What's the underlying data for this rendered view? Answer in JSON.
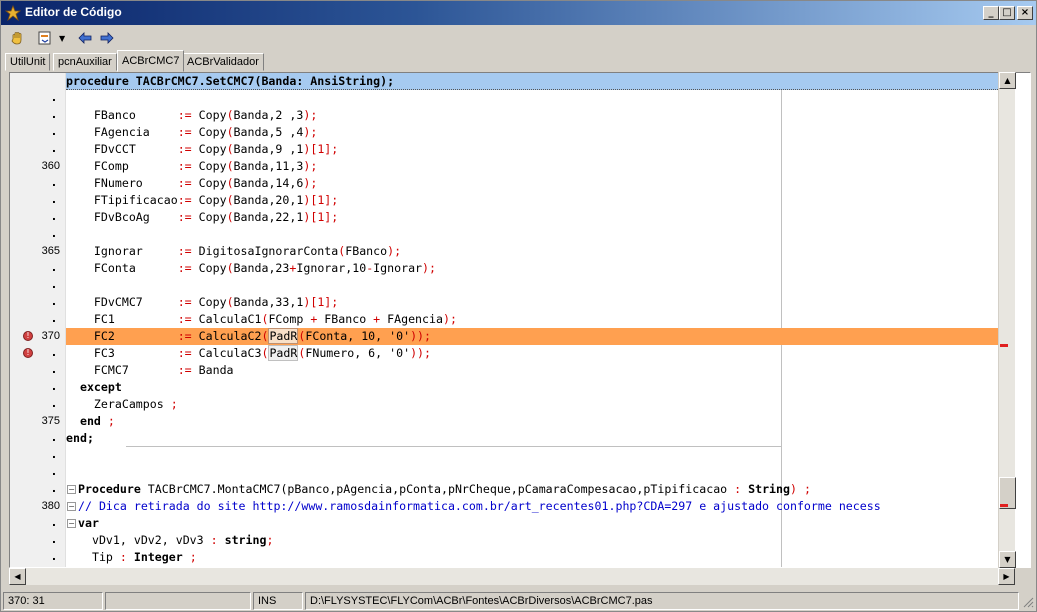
{
  "window": {
    "title": "Editor de Código"
  },
  "tabs": [
    {
      "label": "UtilUnit",
      "active": false
    },
    {
      "label": "pcnAuxiliar",
      "active": false
    },
    {
      "label": "ACBrCMC7",
      "active": true
    },
    {
      "label": "ACBrValidador",
      "active": false
    }
  ],
  "gutter": [
    {
      "n": "",
      "dot": ""
    },
    {
      "n": "",
      "dot": "."
    },
    {
      "n": "",
      "dot": "."
    },
    {
      "n": "",
      "dot": "."
    },
    {
      "n": "",
      "dot": "."
    },
    {
      "n": "360",
      "dot": ""
    },
    {
      "n": "",
      "dot": "."
    },
    {
      "n": "",
      "dot": "."
    },
    {
      "n": "",
      "dot": "."
    },
    {
      "n": "",
      "dot": "."
    },
    {
      "n": "365",
      "dot": ""
    },
    {
      "n": "",
      "dot": "."
    },
    {
      "n": "",
      "dot": "."
    },
    {
      "n": "",
      "dot": "."
    },
    {
      "n": "",
      "dot": "."
    },
    {
      "n": "370",
      "dot": ""
    },
    {
      "n": "",
      "dot": "."
    },
    {
      "n": "",
      "dot": "."
    },
    {
      "n": "",
      "dot": "."
    },
    {
      "n": "",
      "dot": "."
    },
    {
      "n": "375",
      "dot": ""
    },
    {
      "n": "",
      "dot": "."
    },
    {
      "n": "",
      "dot": "."
    },
    {
      "n": "",
      "dot": "."
    },
    {
      "n": "",
      "dot": "."
    },
    {
      "n": "380",
      "dot": ""
    },
    {
      "n": "",
      "dot": "."
    },
    {
      "n": "",
      "dot": "."
    },
    {
      "n": "",
      "dot": "."
    }
  ],
  "code": {
    "l0": "procedure TACBrCMC7.SetCMC7(Banda: AnsiString);",
    "l2a": "    FBanco      ",
    "l2b": ":=",
    "l2c": " Copy",
    "l2d": "(",
    "l2e": "Banda,2 ,3",
    "l2f": ");",
    "l3a": "    FAgencia    ",
    "l3e": "Banda,5 ,4",
    "l4a": "    FDvCCT      ",
    "l4e": "Banda,9 ,1",
    "l4g": ")[1];",
    "l5a": "    FComp       ",
    "l5e": "Banda,11,3",
    "l6a": "    FNumero     ",
    "l6e": "Banda,14,6",
    "l7a": "    FTipificacao",
    "l7e": "Banda,20,1",
    "l8a": "    FDvBcoAg    ",
    "l8e": "Banda,22,1",
    "l10a": "    Ignorar     ",
    "l10c": " DigitosaIgnorarConta",
    "l10e": "FBanco",
    "l11a": "    FConta      ",
    "l11e": "Banda,23",
    "l11p": "+",
    "l11q": "Ignorar,10",
    "l11m": "-",
    "l11r": "Ignorar",
    "l13a": "    FDvCMC7     ",
    "l13e": "Banda,33,1",
    "l14a": "    FC1         ",
    "l14c": " CalculaC1",
    "l14e": "FComp ",
    "l14p": "+",
    "l14q": " FBanco ",
    "l14r": " FAgencia",
    "l15a": "    FC2         ",
    "l15c": " CalculaC2",
    "l15pad": "PadR",
    "l15e": "FConta, 10, '0'",
    "l15f": "));",
    "l16a": "    FC3         ",
    "l16c": " CalculaC3",
    "l16e": "FNumero, 6, '0'",
    "l17a": "    FCMC7       ",
    "l17c": " Banda",
    "l18": "  except",
    "l19": "    ZeraCampos ",
    "l20a": "  end ",
    "l21": "end;",
    "l24a": "Procedure",
    "l24b": " TACBrCMC7.MontaCMC7",
    "l24c": "(pBanco,pAgencia,pConta,pNrCheque,pCamaraCompesacao,pTipificacao ",
    "l24d": ":",
    "l24e": " String",
    "l24f": ") ;",
    "l25": "// Dica retirada do site http://www.ramosdainformatica.com.br/art_recentes01.php?CDA=297 e ajustado conforme necess",
    "l26": "var",
    "l27a": "  vDv1, vDv2, vDv3 ",
    "l27b": ":",
    "l27c": " string",
    "l27d": ";",
    "l28a": "  Tip ",
    "l28b": ":",
    "l28c": " Integer ",
    "l28d": ";"
  },
  "colors": {
    "accent_selection": "#a6caf0",
    "current_line": "#ffa050",
    "keyword_symbol": "#d00000",
    "comment": "#0000cc"
  },
  "status": {
    "position": "370:  31",
    "empty1": "",
    "empty2": "",
    "mode": "INS",
    "file_path": "D:\\FLYSYSTEC\\FLYCom\\ACBr\\Fontes\\ACBrDiversos\\ACBrCMC7.pas"
  },
  "icons": [
    "app-icon",
    "hand-icon",
    "dropdown-icon",
    "back-arrow-icon",
    "forward-arrow-icon",
    "minimize-icon",
    "maximize-icon",
    "close-icon",
    "breakpoint-icon"
  ]
}
